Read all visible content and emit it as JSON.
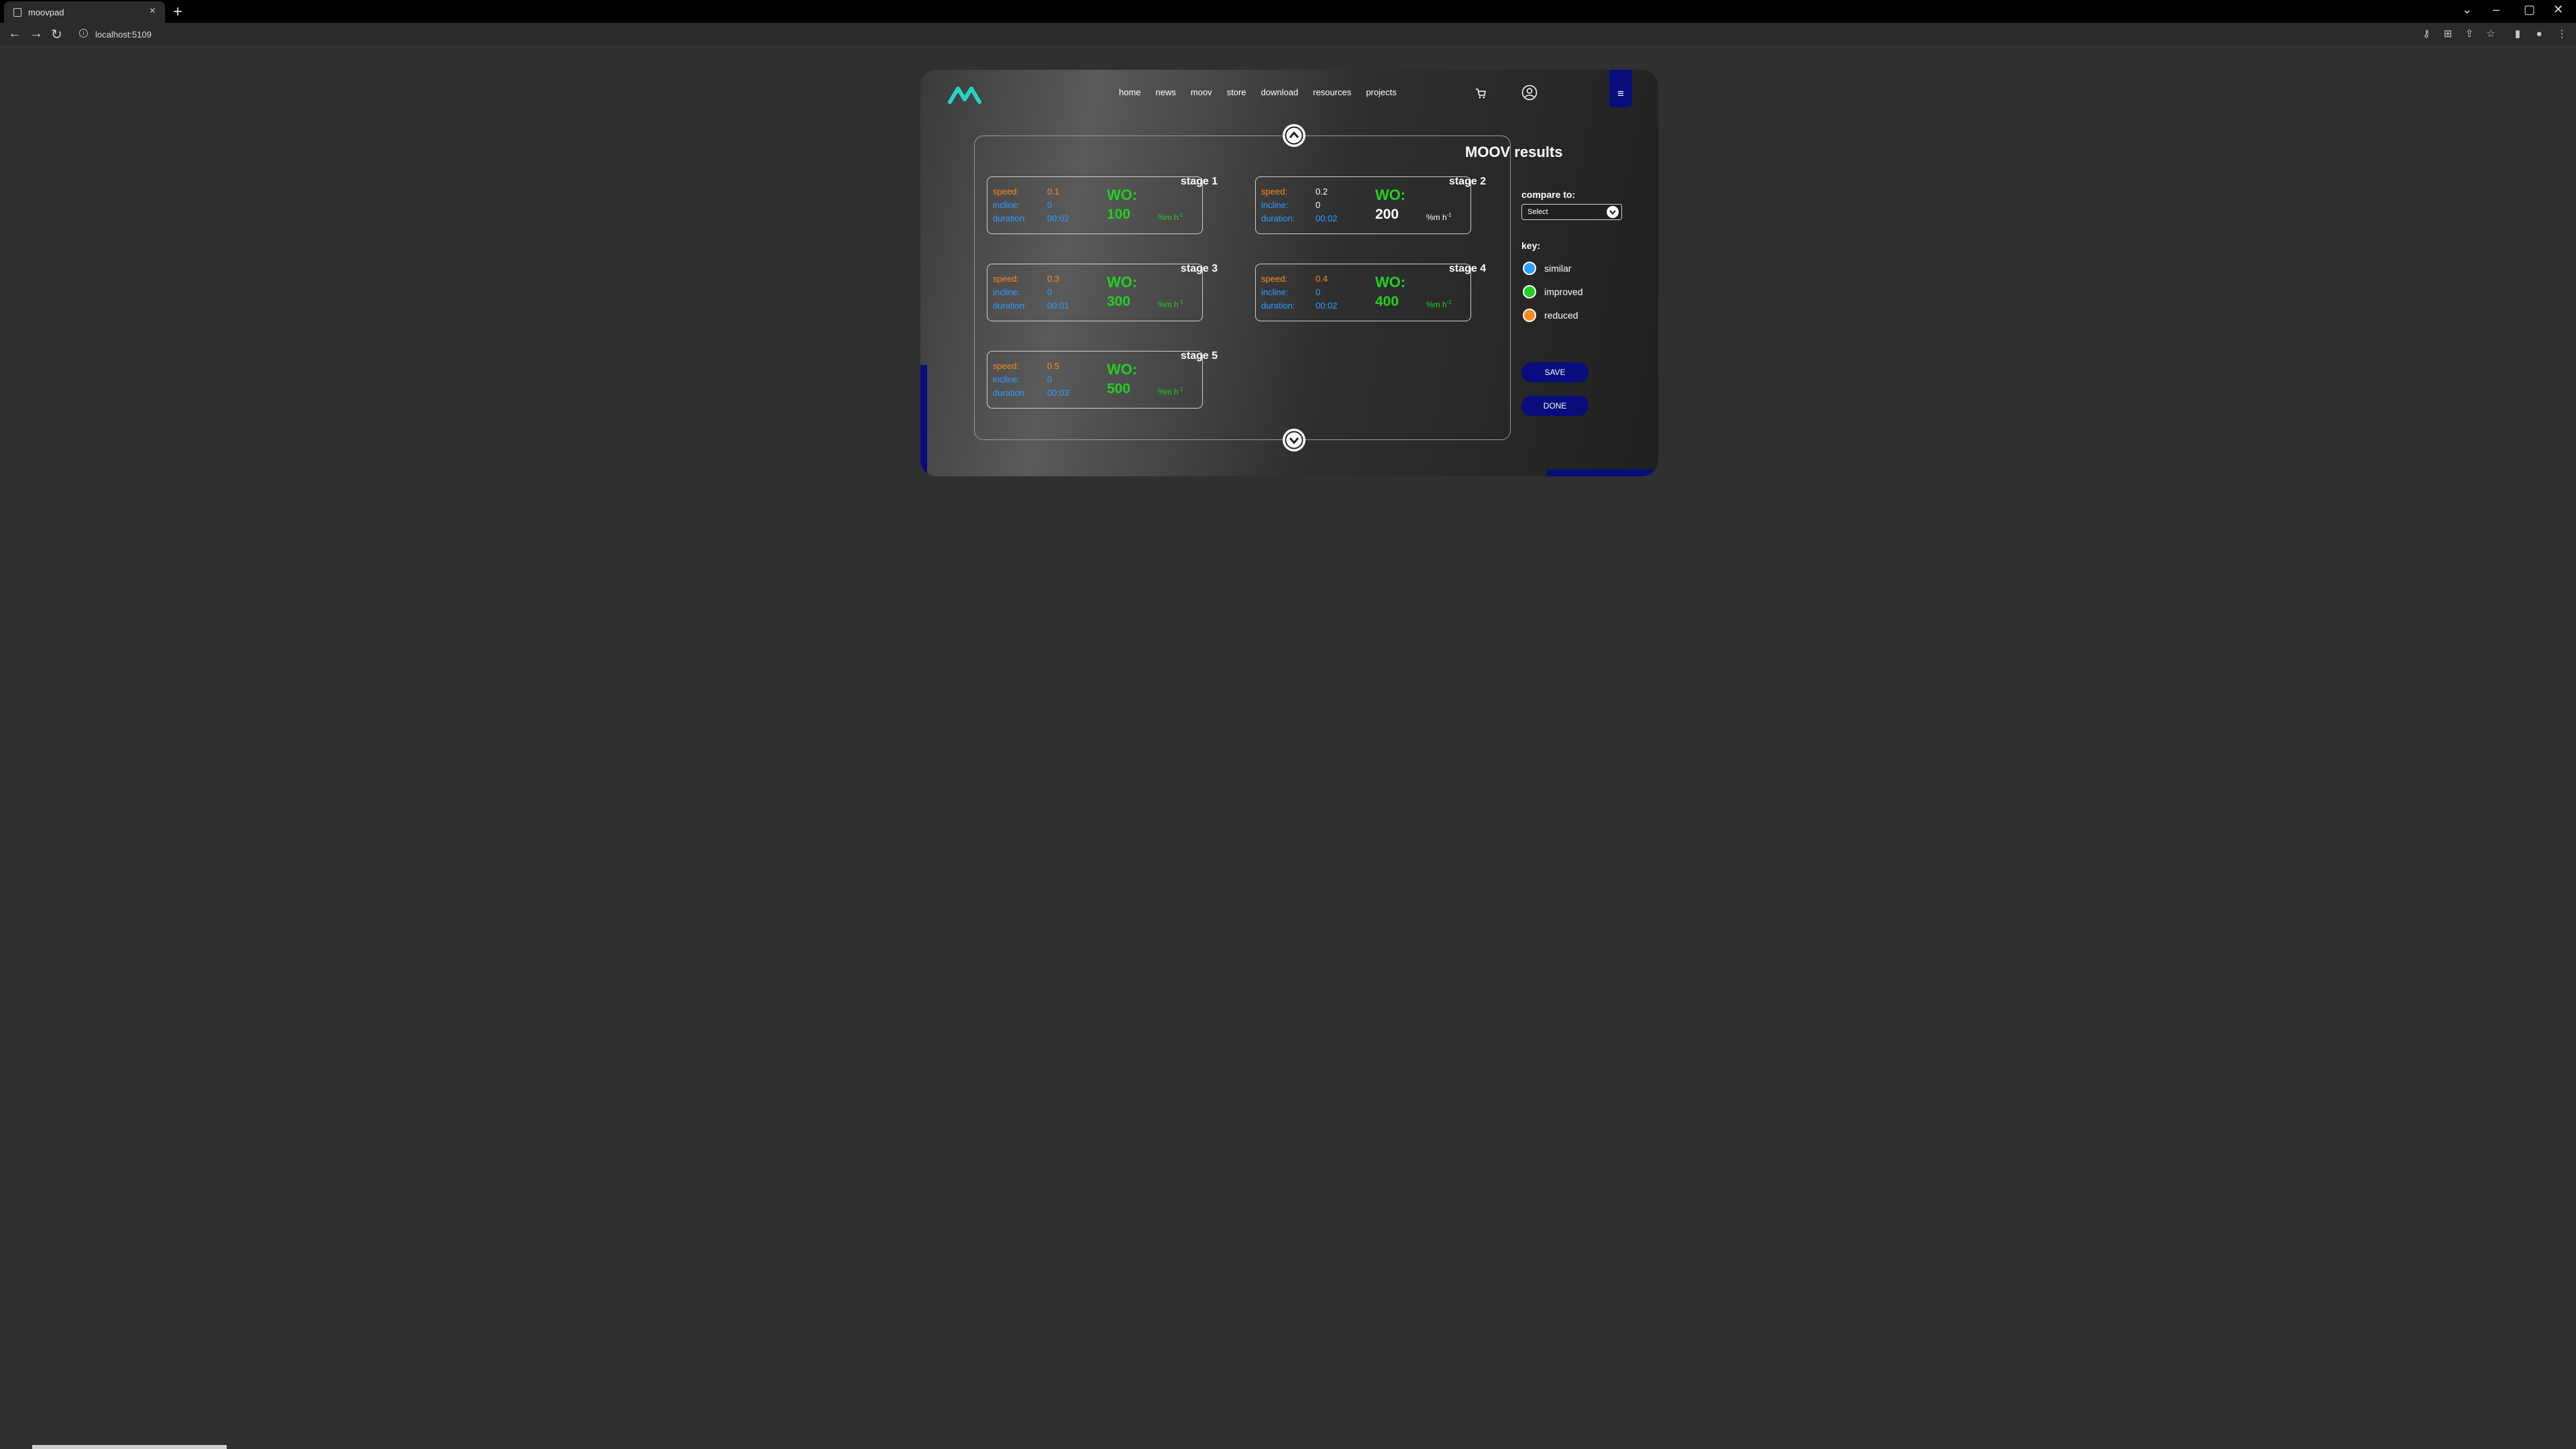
{
  "browser": {
    "tab_title": "moovpad",
    "url": "localhost:5109"
  },
  "nav": [
    "home",
    "news",
    "moov",
    "store",
    "download",
    "resources",
    "projects"
  ],
  "page": {
    "title": "MOOV results",
    "compare_label": "compare to:",
    "compare_value": "Select",
    "key_label": "key:",
    "key_items": [
      {
        "label": "similar",
        "color": "#2f9cff"
      },
      {
        "label": "improved",
        "color": "#22d022"
      },
      {
        "label": "reduced",
        "color": "#ff8a1e"
      }
    ],
    "save_label": "SAVE",
    "done_label": "DONE"
  },
  "labels": {
    "speed": "speed:",
    "incline": "incline:",
    "duration": "duration:",
    "wo": "WO:",
    "unit": "%m h",
    "unit_sup": "-1"
  },
  "stages": [
    {
      "name": "stage 1",
      "speed": "0.1",
      "incline": "0",
      "duration": "00:02",
      "wo": "100"
    },
    {
      "name": "stage 2",
      "speed": "0.2",
      "incline": "0",
      "duration": "00:02",
      "wo": "200"
    },
    {
      "name": "stage 3",
      "speed": "0.3",
      "incline": "0",
      "duration": "00:01",
      "wo": "300"
    },
    {
      "name": "stage 4",
      "speed": "0.4",
      "incline": "0",
      "duration": "00:02",
      "wo": "400"
    },
    {
      "name": "stage 5",
      "speed": "0.5",
      "incline": "0",
      "duration": "00:03",
      "wo": "500"
    }
  ],
  "colors": {
    "accent": "#080c7c",
    "good": "#22d022",
    "blue": "#2f9cff",
    "orange": "#ff8a1e"
  }
}
